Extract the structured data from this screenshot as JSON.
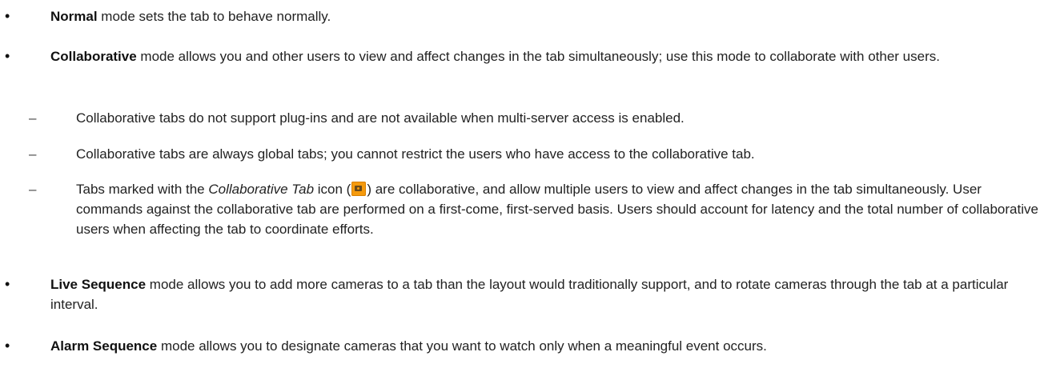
{
  "bullets": {
    "normal": {
      "term": "Normal",
      "text": " mode sets the tab to behave normally."
    },
    "collaborative": {
      "term": "Collaborative",
      "text": " mode allows you and other users to view and affect changes in the tab simultaneously; use this mode to collaborate with other users.",
      "subitems": {
        "s1": "Collaborative tabs do not support plug-ins and are not available when multi-server access is enabled.",
        "s2": "Collaborative tabs are always global tabs; you cannot restrict the users who have access to the collaborative tab.",
        "s3": {
          "before": "Tabs marked with the ",
          "italic": "Collaborative Tab",
          "mid": " icon (",
          "icon": "collaborative-tab-icon",
          "after": ") are collaborative, and allow multiple users to view and affect changes in the tab simultaneously. User commands against the collaborative tab are performed on a first-come, first-served basis. Users should account for latency and the total number of collaborative users when affecting the tab to coordinate efforts."
        }
      }
    },
    "live_sequence": {
      "term": "Live Sequence",
      "text": " mode allows you to add more cameras to a tab than the layout would traditionally support, and to rotate cameras through the tab at a particular interval."
    },
    "alarm_sequence": {
      "term": "Alarm Sequence",
      "text": " mode allows you to designate cameras that you want to watch only when a meaningful event occurs."
    }
  },
  "bullet_char": "•",
  "dash_char": "–",
  "colors": {
    "text": "#222222",
    "icon": "#f59a0c"
  }
}
